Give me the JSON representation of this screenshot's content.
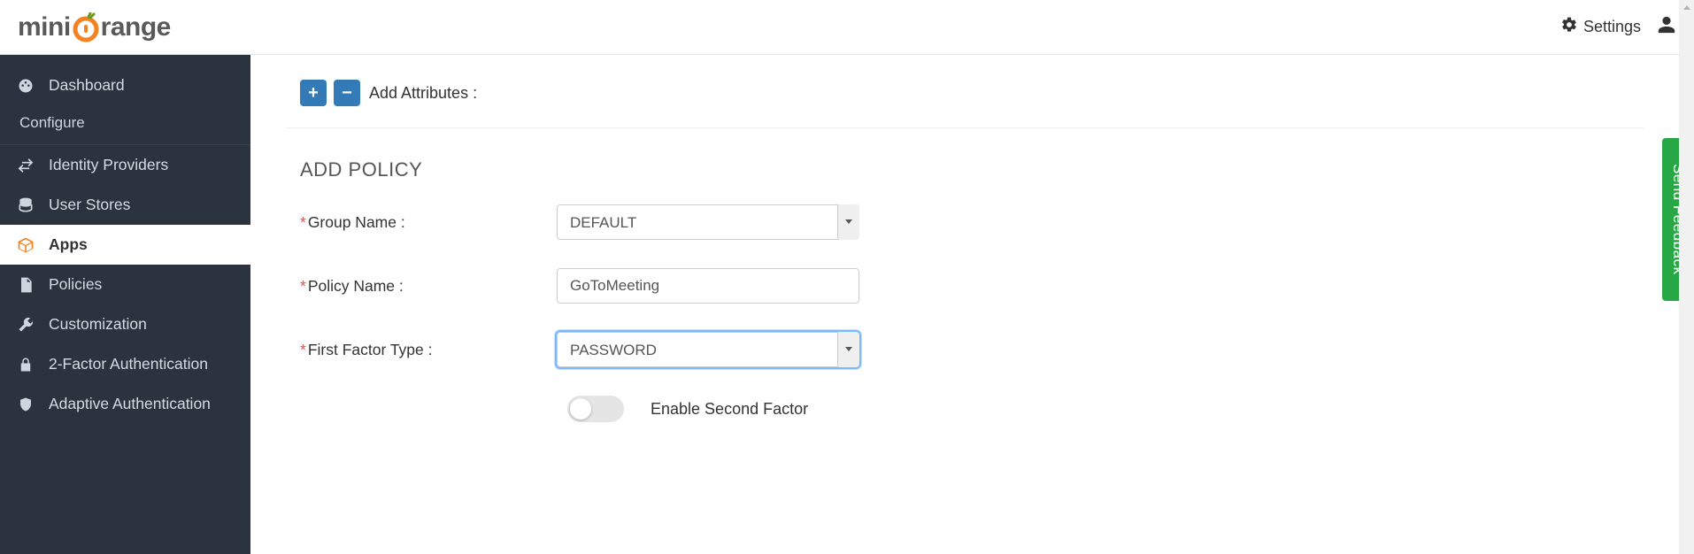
{
  "header": {
    "settings_label": "Settings"
  },
  "sidebar": {
    "dashboard": "Dashboard",
    "configure": "Configure",
    "identity_providers": "Identity Providers",
    "user_stores": "User Stores",
    "apps": "Apps",
    "policies": "Policies",
    "customization": "Customization",
    "two_factor": "2-Factor Authentication",
    "adaptive_auth": "Adaptive Authentication"
  },
  "main": {
    "add_attributes_label": "Add Attributes :",
    "section_title": "ADD POLICY",
    "labels": {
      "group_name": "Group Name :",
      "policy_name": "Policy Name :",
      "first_factor": "First Factor Type :",
      "enable_second_factor": "Enable Second Factor"
    },
    "values": {
      "group_name": "DEFAULT",
      "policy_name": "GoToMeeting",
      "first_factor": "PASSWORD"
    }
  },
  "feedback_label": "Send Feedback"
}
